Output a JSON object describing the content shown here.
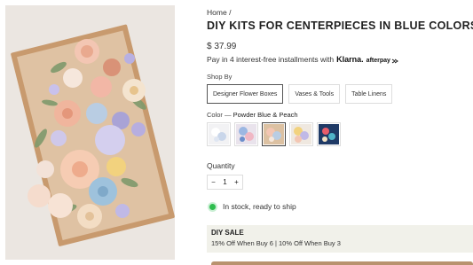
{
  "breadcrumb": {
    "home": "Home",
    "separator": "/"
  },
  "product": {
    "title": "DIY KITS FOR CENTERPIECES IN BLUE COLORS",
    "price": "$ 37.99",
    "installments_text": "Pay in 4 interest-free installments with",
    "klarna_label": "Klarna.",
    "afterpay_label": "afterpay",
    "afterpay_icon": "afterpay-arrows-icon",
    "image_alt_icon": "flower-box-photo"
  },
  "shop_by": {
    "label": "Shop By",
    "options": [
      {
        "label": "Designer Flower Boxes",
        "active": true
      },
      {
        "label": "Vases & Tools",
        "active": false
      },
      {
        "label": "Table Linens",
        "active": false
      }
    ]
  },
  "color": {
    "label": "Color",
    "separator": "—",
    "value": "Powder Blue & Peach",
    "swatches": [
      {
        "name": "white-blue",
        "selected": false
      },
      {
        "name": "blue-pink",
        "selected": false
      },
      {
        "name": "powder-blue-peach",
        "selected": true
      },
      {
        "name": "pastel-mix",
        "selected": false
      },
      {
        "name": "navy-floral",
        "selected": false
      }
    ]
  },
  "quantity": {
    "label": "Quantity",
    "value": "1",
    "minus": "−",
    "plus": "+"
  },
  "stock": {
    "text": "In stock, ready to ship",
    "color": "#2ebd4e"
  },
  "sale": {
    "title": "DIY SALE",
    "text": "15% Off When Buy 6 | 10% Off When Buy 3"
  },
  "colors": {
    "accent": "#b9926e",
    "sale_bg": "#f1f1ea"
  }
}
